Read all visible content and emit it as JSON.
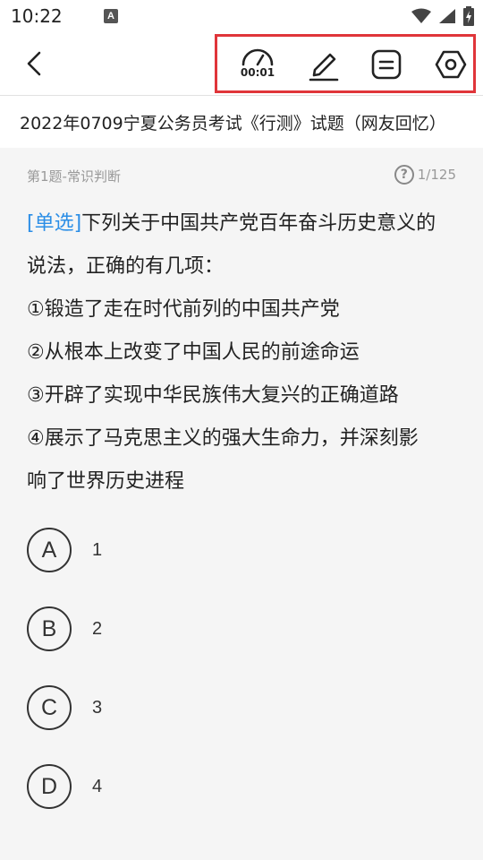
{
  "status_bar": {
    "time": "10:22",
    "notification_glyph": "A"
  },
  "header": {
    "timer_text": "00:01",
    "icons": [
      "back-icon",
      "timer-icon",
      "pen-icon",
      "answer-sheet-icon",
      "settings-icon"
    ]
  },
  "paper": {
    "title": "2022年0709宁夏公务员考试《行测》试题（网友回忆）"
  },
  "question": {
    "meta": "第1题-常识判断",
    "progress": "1/125",
    "help_glyph": "?",
    "type_tag": "[单选]",
    "stem_first": "下列关于中国共产党百年奋斗历史意义的",
    "stem_second": "说法，正确的有几项：",
    "items": [
      "①锻造了走在时代前列的中国共产党",
      "②从根本上改变了中国人民的前途命运",
      "③开辟了实现中华民族伟大复兴的正确道路",
      "④展示了马克思主义的强大生命力，并深刻影",
      "响了世界历史进程"
    ],
    "options": [
      {
        "letter": "A",
        "text": "1"
      },
      {
        "letter": "B",
        "text": "2"
      },
      {
        "letter": "C",
        "text": "3"
      },
      {
        "letter": "D",
        "text": "4"
      }
    ]
  },
  "colors": {
    "accent": "#2b8ee6",
    "highlight_box": "#e0353a",
    "page_bg": "#f5f5f5"
  }
}
